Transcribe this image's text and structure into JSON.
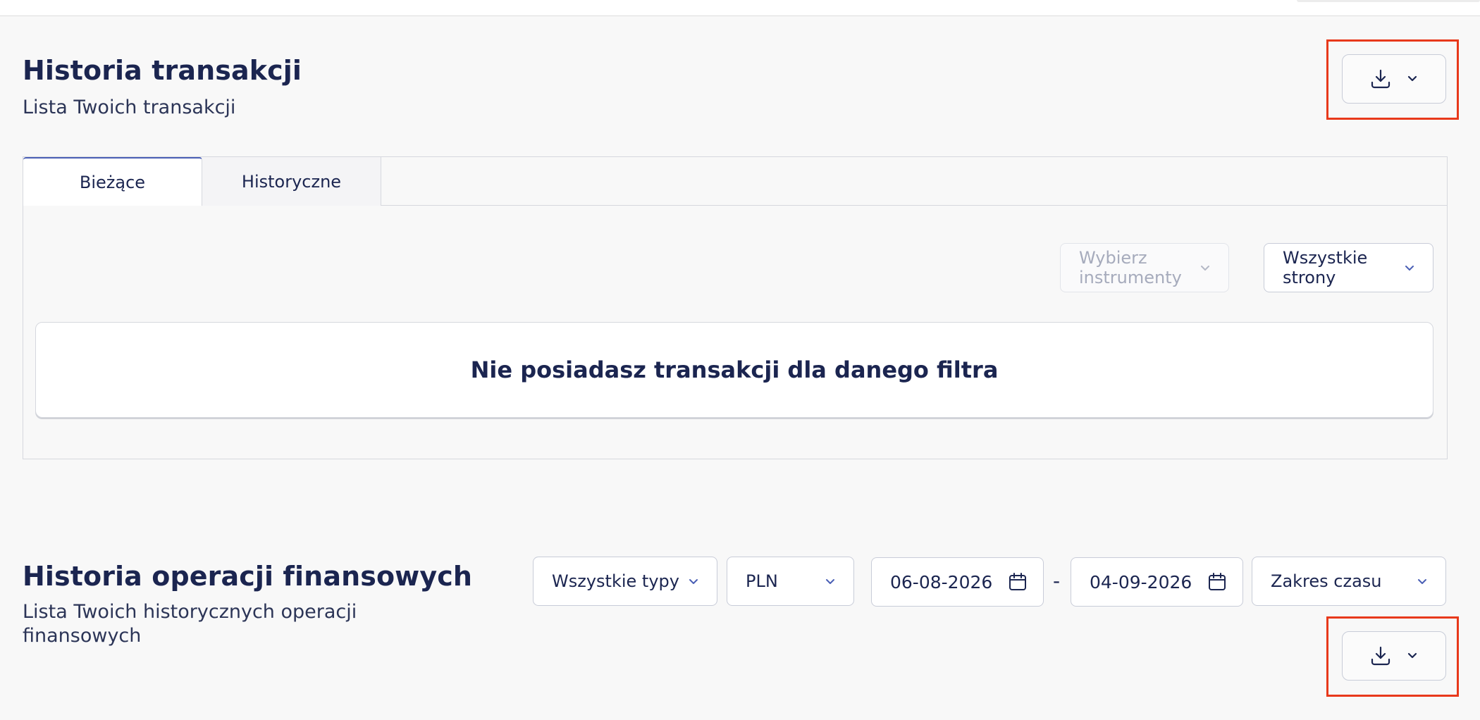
{
  "transactions": {
    "title": "Historia transakcji",
    "subtitle": "Lista Twoich transakcji",
    "tabs": [
      {
        "label": "Bieżące",
        "active": true
      },
      {
        "label": "Historyczne",
        "active": false
      }
    ],
    "instrument_select": {
      "placeholder": "Wybierz instrumenty",
      "disabled": true
    },
    "side_select": {
      "value": "Wszystkie strony"
    },
    "empty_message": "Nie posiadasz transakcji dla danego filtra",
    "download_icon": "download-icon",
    "dropdown_icon": "chevron-down-icon"
  },
  "operations": {
    "title": "Historia operacji finansowych",
    "subtitle": "Lista Twoich historycznych operacji finansowych",
    "type_select": {
      "value": "Wszystkie typy"
    },
    "currency_select": {
      "value": "PLN"
    },
    "date_from": "06-08-2026",
    "date_separator": "-",
    "date_to": "04-09-2026",
    "range_select": {
      "value": "Zakres czasu"
    },
    "calendar_icon": "calendar-icon",
    "download_icon": "download-icon"
  },
  "colors": {
    "highlight": "#e8391b",
    "text": "#1b2550",
    "accent": "#4a5fb5",
    "background": "#f8f8f8"
  }
}
